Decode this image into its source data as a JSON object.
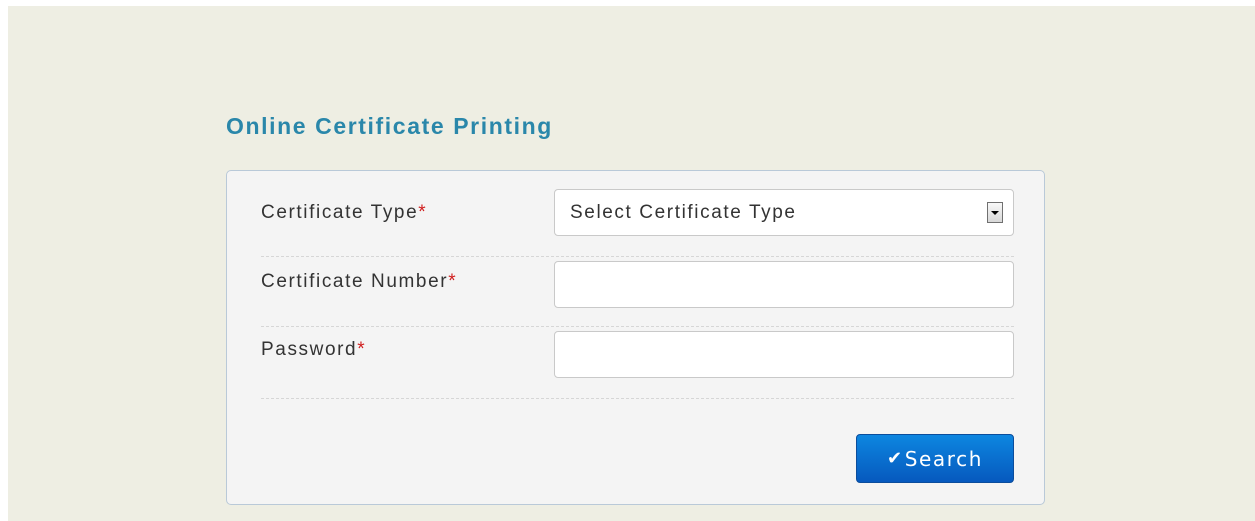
{
  "page": {
    "title": "Online Certificate Printing"
  },
  "form": {
    "certificate_type": {
      "label": "Certificate Type",
      "required_mark": "*",
      "selected": "Select Certificate Type"
    },
    "certificate_number": {
      "label": "Certificate Number",
      "required_mark": "*",
      "value": ""
    },
    "password": {
      "label": "Password",
      "required_mark": "*",
      "value": ""
    },
    "search_button": {
      "icon": "check-icon",
      "icon_glyph": "✔",
      "label": "Search"
    }
  },
  "colors": {
    "background": "#eeeee3",
    "title": "#2a87aa",
    "required": "#d01e1e",
    "button": "#0b6fd4"
  }
}
